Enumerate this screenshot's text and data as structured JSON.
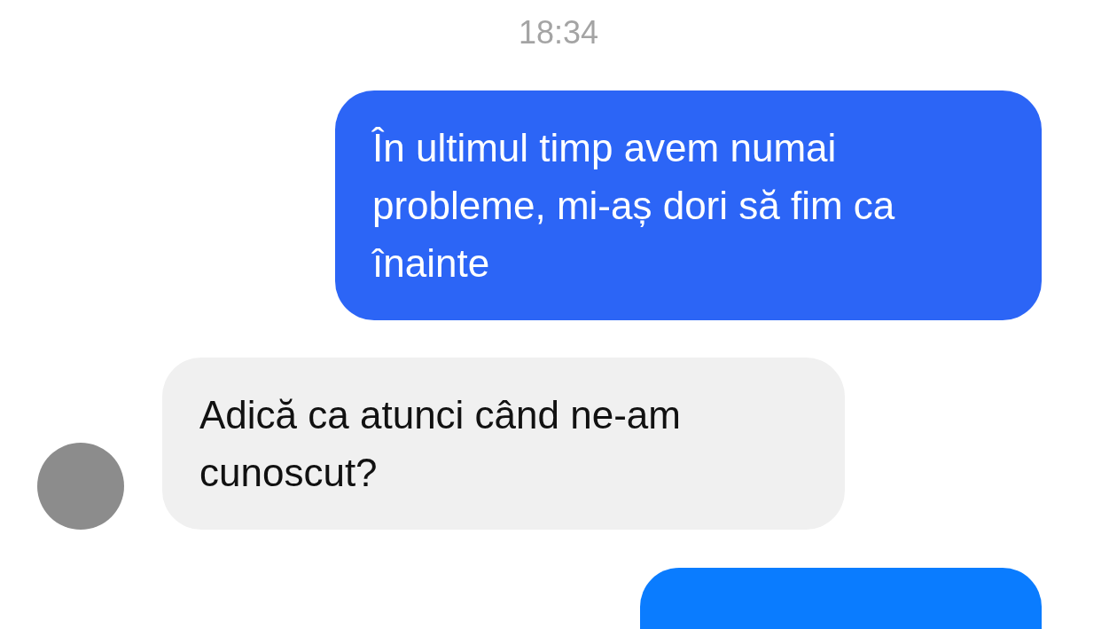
{
  "timestamp": "18:34",
  "messages": [
    {
      "kind": "sent",
      "text": "În ultimul timp avem numai probleme, mi-aș dori să fim ca înainte"
    },
    {
      "kind": "received",
      "text": "Adică ca atunci când ne-am cunoscut?"
    },
    {
      "kind": "sent_cut"
    }
  ]
}
